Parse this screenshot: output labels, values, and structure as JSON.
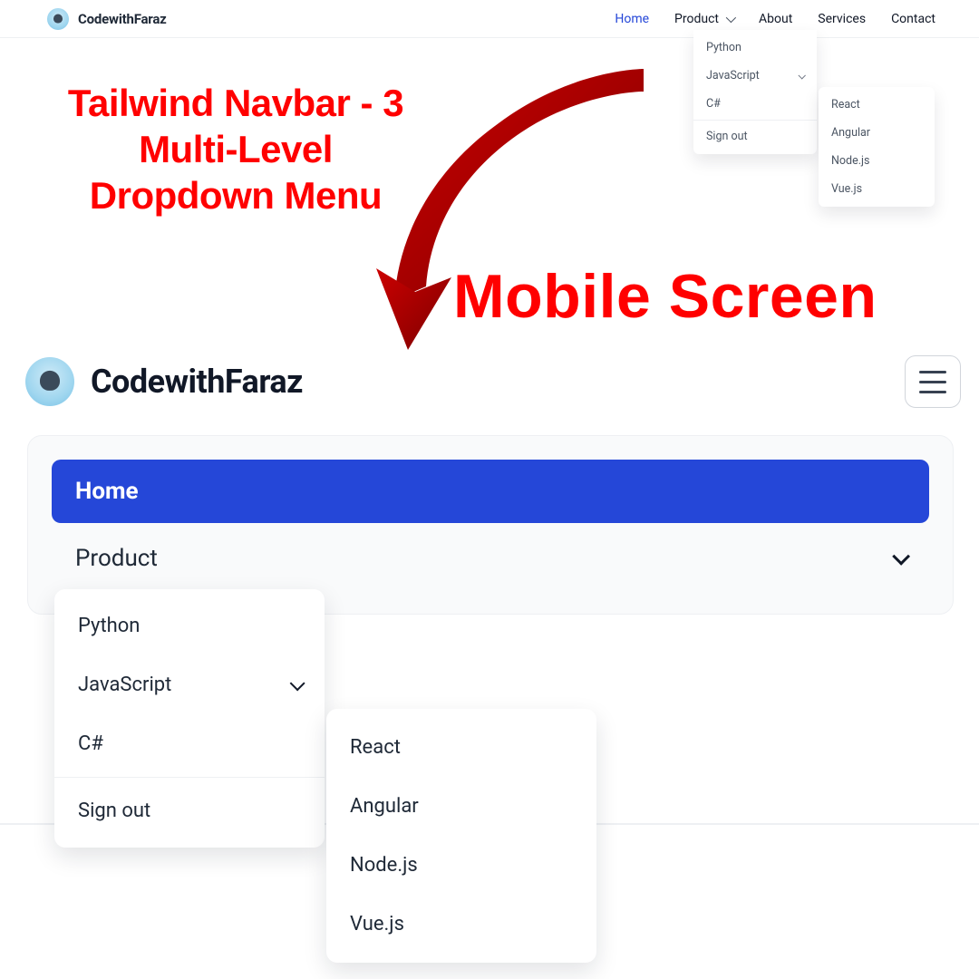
{
  "brand": {
    "name": "CodewithFaraz"
  },
  "nav": {
    "home": "Home",
    "product": "Product",
    "about": "About",
    "services": "Services",
    "contact": "Contact"
  },
  "dropdown1": {
    "python": "Python",
    "javascript": "JavaScript",
    "csharp": "C#",
    "signout": "Sign out"
  },
  "dropdown2": {
    "react": "React",
    "angular": "Angular",
    "nodejs": "Node.js",
    "vuejs": "Vue.js"
  },
  "annotations": {
    "title_l1": "Tailwind Navbar - 3",
    "title_l2": "Multi-Level",
    "title_l3": "Dropdown Menu",
    "mobile": "Mobile Screen"
  },
  "mobile_menu": {
    "home": "Home",
    "product": "Product"
  },
  "mobile_dd1": {
    "python": "Python",
    "javascript": "JavaScript",
    "csharp": "C#",
    "signout": "Sign out"
  },
  "mobile_dd2": {
    "react": "React",
    "angular": "Angular",
    "nodejs": "Node.js",
    "vuejs": "Vue.js"
  }
}
